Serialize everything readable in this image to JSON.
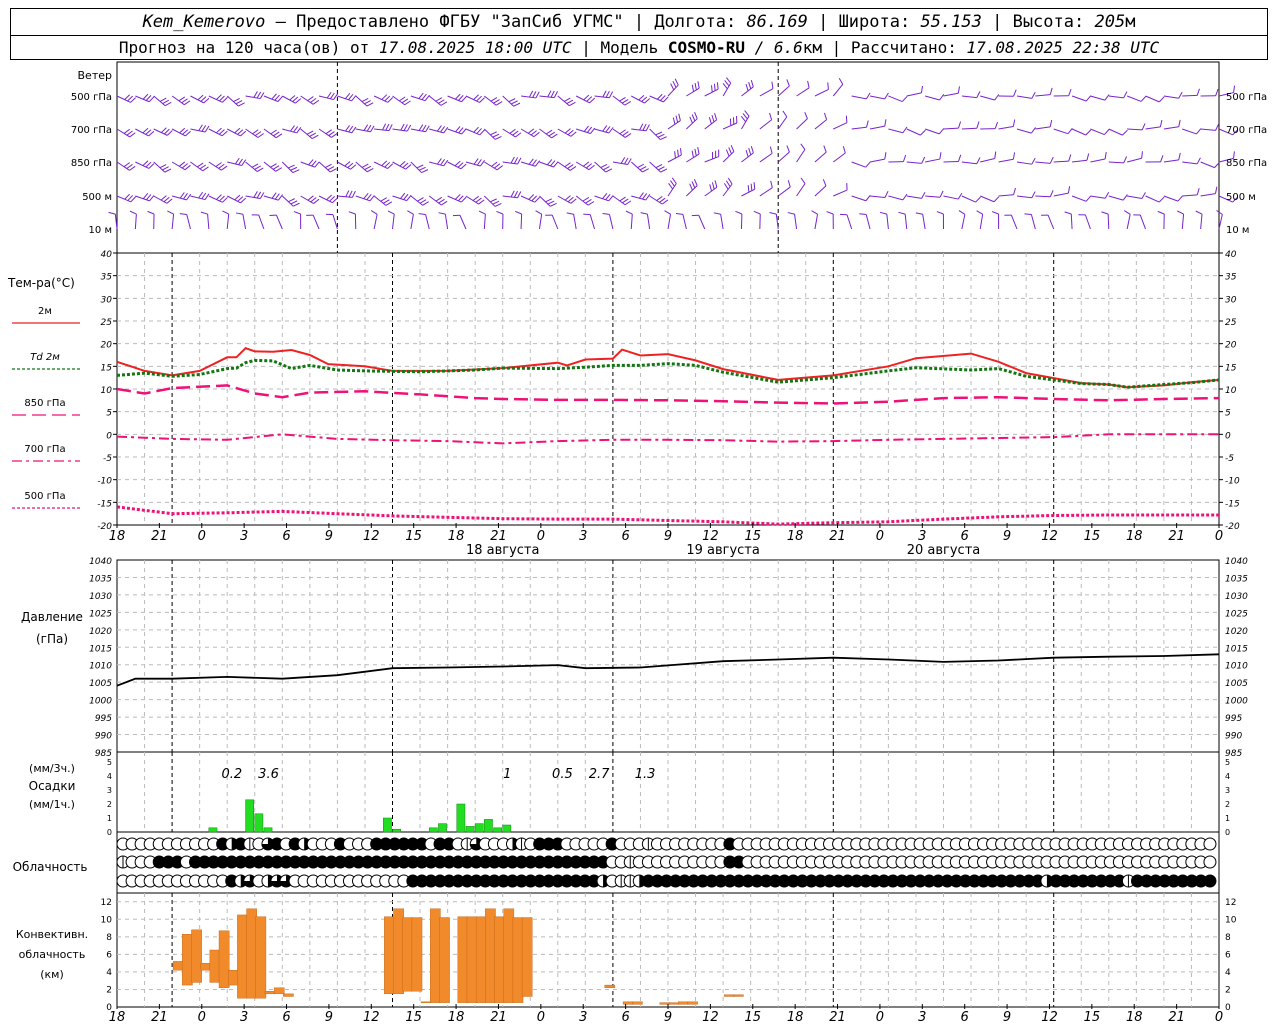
{
  "header": {
    "station": "Kem_Kemerovo",
    "provider": " — Предоставлено ФГБУ \"ЗапСиб УГМС\" | Долгота: ",
    "lon": "86.169",
    "lat_label": " | Широта: ",
    "lat": "55.153",
    "alt_label": " | Высота: ",
    "alt": "205",
    "alt_unit": "м",
    "forecast_label": "Прогноз на 120 часа(ов) от ",
    "forecast_time": "17.08.2025 18:00 UTC",
    "model_label": " | Модель ",
    "model": "COSMO-RU",
    "model_res": " / 6.6",
    "model_res_unit": "км",
    "calc_label": " | Рассчитано: ",
    "calc_time": "17.08.2025 22:38 UTC"
  },
  "x_ticks": [
    "18",
    "21",
    "0",
    "3",
    "6",
    "9",
    "12",
    "15",
    "18",
    "21",
    "0",
    "3",
    "6",
    "9",
    "12",
    "15",
    "18",
    "21",
    "0",
    "3",
    "6",
    "9",
    "12",
    "15",
    "18",
    "21",
    "0"
  ],
  "dates": [
    "18 августа",
    "19 августа",
    "20 августа"
  ],
  "wind": {
    "title": "Ветер",
    "levels": [
      "500 гПа",
      "700 гПа",
      "850 гПа",
      "500 м",
      "10 м"
    ]
  },
  "temperature": {
    "title": "Тем-ра(°C)",
    "legend": [
      {
        "label": "2м",
        "color": "#ee2222",
        "style": "solid"
      },
      {
        "label": "Td  2м",
        "color": "#117711",
        "style": "dotted"
      },
      {
        "label": "850 гПа",
        "color": "#ee1177",
        "style": "dash"
      },
      {
        "label": "700 гПа",
        "color": "#ee1177",
        "style": "dashdot"
      },
      {
        "label": "500 гПа",
        "color": "#ee1177",
        "style": "dot"
      }
    ],
    "y_ticks": [
      "40",
      "35",
      "30",
      "25",
      "20",
      "15",
      "10",
      "5",
      "0",
      "-5",
      "-10",
      "-15",
      "-20"
    ],
    "ylim": [
      -20,
      40
    ]
  },
  "pressure": {
    "title1": "Давление",
    "title2": "(гПа)",
    "y_ticks": [
      "1040",
      "1035",
      "1030",
      "1025",
      "1020",
      "1015",
      "1010",
      "1005",
      "1000",
      "995",
      "990",
      "985"
    ],
    "ylim": [
      985,
      1040
    ]
  },
  "precip": {
    "title1": "(мм/3ч.)",
    "title2": "Осадки",
    "title3": "(мм/1ч.)",
    "y_ticks": [
      "5",
      "4",
      "3",
      "2",
      "1",
      "0"
    ],
    "totals": [
      {
        "h": 12.5,
        "label": "0.2"
      },
      {
        "h": 16.5,
        "label": "3.6"
      },
      {
        "h": 42.5,
        "label": "1"
      },
      {
        "h": 48.5,
        "label": "0.5"
      },
      {
        "h": 52.5,
        "label": "2.7"
      },
      {
        "h": 57.5,
        "label": "1.3"
      }
    ]
  },
  "cloud": {
    "title": "Облачность"
  },
  "convective": {
    "title1": "Конвективн.",
    "title2": "облачность",
    "title3": "(км)",
    "y_ticks": [
      "12",
      "10",
      "8",
      "6",
      "4",
      "2",
      "0"
    ]
  },
  "chart_data": [
    {
      "type": "line",
      "title": "Тем-ра(°C)",
      "x_hours_from": "17.08.2025 18:00 UTC",
      "ylim": [
        -20,
        40
      ],
      "series": [
        {
          "name": "2м",
          "color": "#ee2222",
          "points": [
            [
              0,
              16
            ],
            [
              3,
              14
            ],
            [
              6,
              13
            ],
            [
              9,
              14
            ],
            [
              12,
              17
            ],
            [
              13,
              17
            ],
            [
              14,
              19
            ],
            [
              15,
              18.3
            ],
            [
              17,
              18.2
            ],
            [
              19,
              18.6
            ],
            [
              21,
              17.5
            ],
            [
              23,
              15.5
            ],
            [
              27,
              15
            ],
            [
              30,
              14
            ],
            [
              36,
              14
            ],
            [
              42,
              14.6
            ],
            [
              48,
              15.8
            ],
            [
              49,
              15.2
            ],
            [
              51,
              16.5
            ],
            [
              54,
              16.7
            ],
            [
              55,
              18.7
            ],
            [
              57,
              17.4
            ],
            [
              60,
              17.7
            ],
            [
              63,
              16.3
            ],
            [
              66,
              14.4
            ],
            [
              72,
              12
            ],
            [
              78,
              13
            ],
            [
              84,
              15
            ],
            [
              87,
              16.8
            ],
            [
              93,
              17.8
            ],
            [
              96,
              16
            ],
            [
              99,
              13.5
            ],
            [
              105,
              11.3
            ],
            [
              108,
              11
            ],
            [
              110,
              10.4
            ],
            [
              114,
              10.8
            ],
            [
              117,
              11.5
            ],
            [
              120,
              12
            ]
          ]
        },
        {
          "name": "Td  2м",
          "color": "#117711",
          "points": [
            [
              0,
              13
            ],
            [
              3,
              13.5
            ],
            [
              6,
              12.8
            ],
            [
              9,
              13.2
            ],
            [
              12,
              14.5
            ],
            [
              13,
              14.6
            ],
            [
              14,
              15.8
            ],
            [
              15,
              16.3
            ],
            [
              17,
              16.2
            ],
            [
              19,
              14.5
            ],
            [
              21,
              15.2
            ],
            [
              24,
              14.2
            ],
            [
              27,
              14
            ],
            [
              33,
              13.8
            ],
            [
              39,
              14.2
            ],
            [
              42,
              14.6
            ],
            [
              48,
              14.5
            ],
            [
              51,
              14.8
            ],
            [
              54,
              15.2
            ],
            [
              57,
              15.2
            ],
            [
              60,
              15.6
            ],
            [
              63,
              15.2
            ],
            [
              66,
              13.7
            ],
            [
              72,
              11.5
            ],
            [
              78,
              12.5
            ],
            [
              84,
              14
            ],
            [
              87,
              14.7
            ],
            [
              93,
              14.2
            ],
            [
              96,
              14.5
            ],
            [
              99,
              12.8
            ],
            [
              105,
              11.2
            ],
            [
              108,
              11
            ],
            [
              110,
              10.4
            ],
            [
              114,
              11
            ],
            [
              117,
              11.4
            ],
            [
              120,
              12
            ]
          ]
        },
        {
          "name": "850 гПа",
          "color": "#ee1177",
          "points": [
            [
              0,
              10
            ],
            [
              3,
              9
            ],
            [
              6,
              10.2
            ],
            [
              12,
              10.8
            ],
            [
              15,
              9
            ],
            [
              18,
              8.2
            ],
            [
              21,
              9.2
            ],
            [
              27,
              9.5
            ],
            [
              33,
              8.8
            ],
            [
              39,
              8
            ],
            [
              42,
              7.8
            ],
            [
              48,
              7.6
            ],
            [
              54,
              7.6
            ],
            [
              60,
              7.5
            ],
            [
              66,
              7.3
            ],
            [
              72,
              7
            ],
            [
              78,
              6.8
            ],
            [
              84,
              7.2
            ],
            [
              90,
              8
            ],
            [
              96,
              8.2
            ],
            [
              102,
              7.8
            ],
            [
              108,
              7.5
            ],
            [
              114,
              7.8
            ],
            [
              120,
              8
            ]
          ]
        },
        {
          "name": "700 гПа",
          "color": "#ee1177",
          "points": [
            [
              0,
              -0.5
            ],
            [
              6,
              -1
            ],
            [
              12,
              -1.2
            ],
            [
              18,
              0
            ],
            [
              24,
              -1
            ],
            [
              30,
              -1.3
            ],
            [
              36,
              -1.5
            ],
            [
              42,
              -2
            ],
            [
              48,
              -1.5
            ],
            [
              54,
              -1.2
            ],
            [
              60,
              -1.2
            ],
            [
              66,
              -1.3
            ],
            [
              72,
              -1.6
            ],
            [
              78,
              -1.5
            ],
            [
              84,
              -1.2
            ],
            [
              90,
              -1
            ],
            [
              96,
              -0.8
            ],
            [
              102,
              -0.6
            ],
            [
              108,
              0
            ],
            [
              114,
              0
            ],
            [
              120,
              0
            ]
          ]
        },
        {
          "name": "500 гПа",
          "color": "#ee1177",
          "points": [
            [
              0,
              -16
            ],
            [
              6,
              -17.5
            ],
            [
              12,
              -17.3
            ],
            [
              18,
              -17
            ],
            [
              24,
              -17.5
            ],
            [
              30,
              -18
            ],
            [
              36,
              -18.3
            ],
            [
              42,
              -18.6
            ],
            [
              48,
              -18.7
            ],
            [
              54,
              -18.7
            ],
            [
              60,
              -19
            ],
            [
              66,
              -19.3
            ],
            [
              72,
              -19.8
            ],
            [
              78,
              -19.5
            ],
            [
              84,
              -19.3
            ],
            [
              90,
              -18.7
            ],
            [
              96,
              -18.2
            ],
            [
              102,
              -17.9
            ],
            [
              108,
              -17.8
            ],
            [
              114,
              -17.8
            ],
            [
              120,
              -17.8
            ]
          ]
        }
      ]
    },
    {
      "type": "line",
      "title": "Давление (гПа)",
      "ylim": [
        985,
        1040
      ],
      "series": [
        {
          "name": "",
          "color": "#000000",
          "points": [
            [
              0,
              1004
            ],
            [
              2,
              1006
            ],
            [
              6,
              1006
            ],
            [
              12,
              1006.5
            ],
            [
              18,
              1006
            ],
            [
              24,
              1007
            ],
            [
              30,
              1009
            ],
            [
              36,
              1009.2
            ],
            [
              42,
              1009.5
            ],
            [
              48,
              1009.9
            ],
            [
              51,
              1009
            ],
            [
              57,
              1009.2
            ],
            [
              60,
              1009.8
            ],
            [
              66,
              1011
            ],
            [
              72,
              1011.5
            ],
            [
              78,
              1012
            ],
            [
              84,
              1011.5
            ],
            [
              90,
              1010.8
            ],
            [
              96,
              1011.2
            ],
            [
              102,
              1012
            ],
            [
              108,
              1012.3
            ],
            [
              114,
              1012.5
            ],
            [
              120,
              1013
            ]
          ]
        }
      ]
    },
    {
      "type": "bar",
      "title": "Осадки (мм/1ч.)",
      "ylim": [
        0,
        5
      ],
      "x": [
        10,
        14,
        15,
        16,
        29,
        30,
        34,
        35,
        37,
        38,
        39,
        40,
        41,
        42
      ],
      "values": [
        0.3,
        2.3,
        1.3,
        0.3,
        1.0,
        0.2,
        0.3,
        0.6,
        2.0,
        0.4,
        0.6,
        0.9,
        0.3,
        0.5
      ]
    },
    {
      "type": "bar",
      "title": "Конвективн. облачность (км)",
      "ylim": [
        0,
        13
      ],
      "ranges": [
        [
          6,
          4.2,
          5.2
        ],
        [
          7,
          2.5,
          8.3
        ],
        [
          8,
          2.8,
          8.8
        ],
        [
          9,
          4.2,
          5.0
        ],
        [
          10,
          2.8,
          6.5
        ],
        [
          11,
          2.2,
          8.7
        ],
        [
          12,
          2.5,
          4.2
        ],
        [
          13,
          1,
          10.5
        ],
        [
          14,
          1,
          11.2
        ],
        [
          15,
          1,
          10.3
        ],
        [
          16,
          1.5,
          1.8
        ],
        [
          17,
          1.5,
          2.2
        ],
        [
          18,
          1.2,
          1.5
        ],
        [
          29,
          1.5,
          10.3
        ],
        [
          30,
          1.5,
          11.2
        ],
        [
          31,
          1.8,
          10.2
        ],
        [
          32,
          1.8,
          10.2
        ],
        [
          33,
          0.5,
          0.6
        ],
        [
          34,
          0.5,
          11.2
        ],
        [
          35,
          0.5,
          10.2
        ],
        [
          37,
          0.5,
          10.3
        ],
        [
          38,
          0.5,
          10.3
        ],
        [
          39,
          0.5,
          10.3
        ],
        [
          40,
          0.5,
          11.2
        ],
        [
          41,
          0.5,
          10.3
        ],
        [
          42,
          0.5,
          11.2
        ],
        [
          43,
          0.5,
          10.2
        ],
        [
          44,
          1.2,
          10.2
        ],
        [
          53,
          2.2,
          2.5
        ],
        [
          55,
          0.3,
          0.6
        ],
        [
          56,
          0.3,
          0.6
        ],
        [
          59,
          0.3,
          0.5
        ],
        [
          60,
          0.3,
          0.5
        ],
        [
          61,
          0.3,
          0.6
        ],
        [
          62,
          0.3,
          0.6
        ],
        [
          66,
          1.2,
          1.4
        ],
        [
          67,
          1.2,
          1.4
        ]
      ]
    },
    {
      "type": "table",
      "title": "Облачность",
      "rows": [
        "0000000000012130410120001000111111011034000230111000001000300000000100000000000000000000000000000000000000000000000000000",
        "3000111011111111111111111111111111111111111111111111110030000000000110000000000000000000000000000000000000000000000000000",
        "0000000000001240244000000000000011111111111111111111120332111111111111111111111111111111111111111111112111111113111111111"
      ]
    }
  ]
}
